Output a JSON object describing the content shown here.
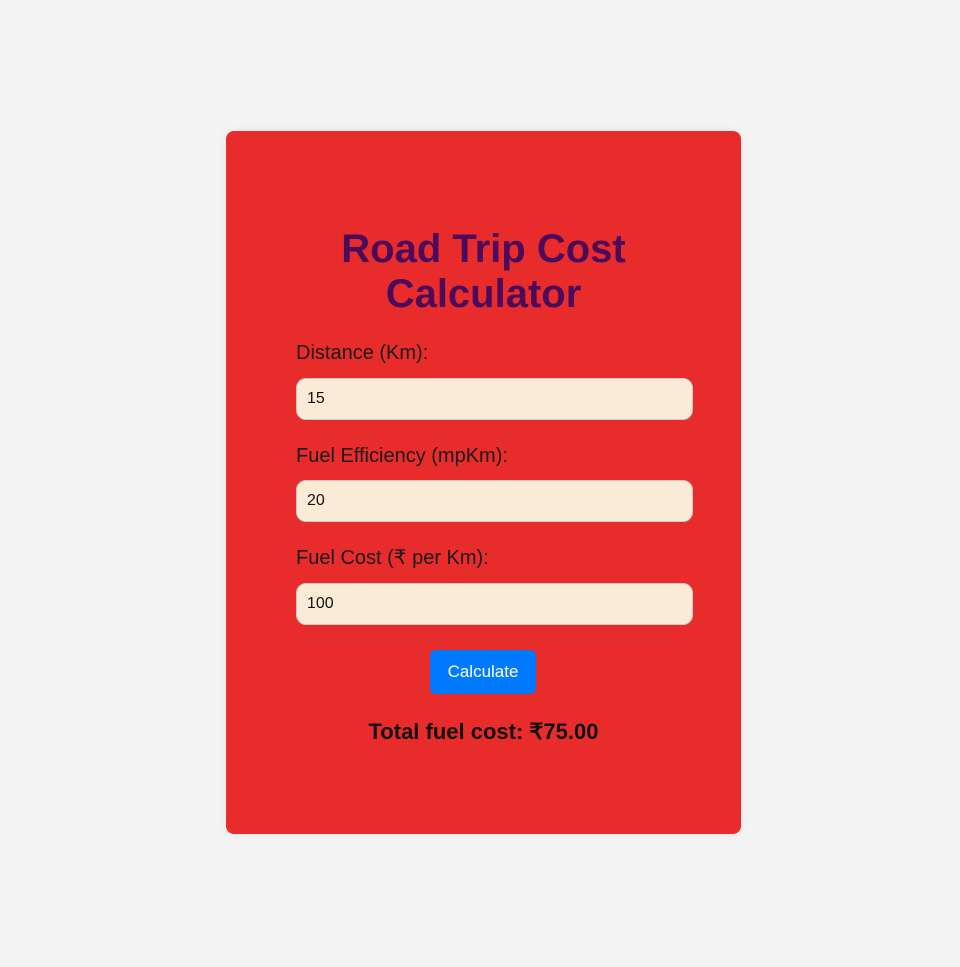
{
  "app": {
    "title_line1": "Road Trip Cost",
    "title_line2": "Calculator"
  },
  "form": {
    "distance": {
      "label": "Distance (Km):",
      "value": "15"
    },
    "efficiency": {
      "label": "Fuel Efficiency (mpKm):",
      "value": "20"
    },
    "cost": {
      "label": "Fuel Cost (₹ per Km):",
      "value": "100"
    },
    "calculate_label": "Calculate"
  },
  "result": {
    "text": "Total fuel cost: ₹75.00"
  },
  "colors": {
    "page_background": "#f4f4f4",
    "card_background": "#e82c2c",
    "title": "#4b0a5a",
    "input_background": "#faebd7",
    "button_background": "#007bff",
    "button_text": "#ffffff"
  }
}
